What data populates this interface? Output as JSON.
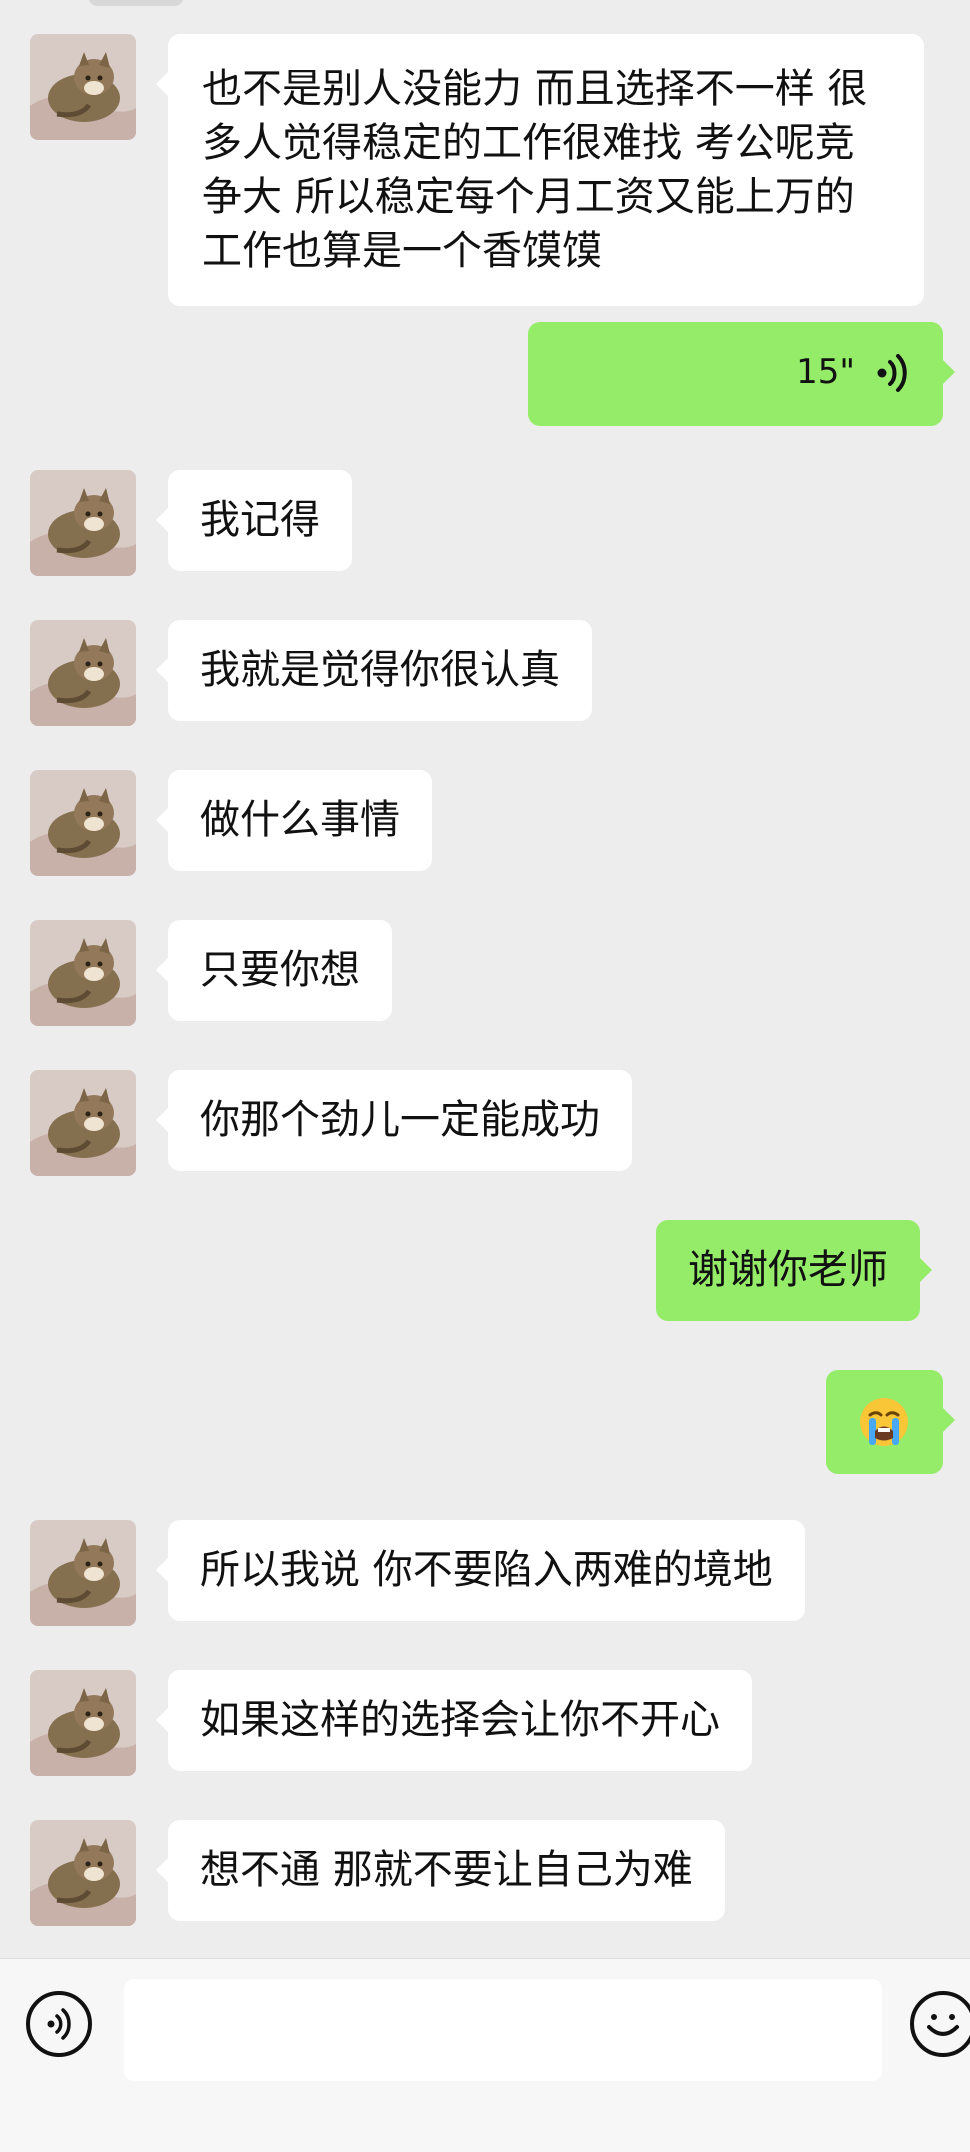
{
  "messages": [
    {
      "side": "left",
      "text": "也不是别人没能力 而且选择不一样 很多人觉得稳定的工作很难找 考公呢竞争大 所以稳定每个月工资又能上万的工作也算是一个香馍馍"
    },
    {
      "side": "right",
      "type": "voice",
      "duration": "15\""
    },
    {
      "side": "left",
      "text": "我记得"
    },
    {
      "side": "left",
      "text": "我就是觉得你很认真"
    },
    {
      "side": "left",
      "text": "做什么事情"
    },
    {
      "side": "left",
      "text": "只要你想"
    },
    {
      "side": "left",
      "text": "你那个劲儿一定能成功"
    },
    {
      "side": "right",
      "text": "谢谢你老师"
    },
    {
      "side": "right",
      "type": "emoji",
      "emoji": "loudly-crying-face"
    },
    {
      "side": "left",
      "text": "所以我说 你不要陷入两难的境地"
    },
    {
      "side": "left",
      "text": "如果这样的选择会让你不开心"
    },
    {
      "side": "left",
      "text": "想不通 那就不要让自己为难"
    }
  ],
  "colors": {
    "chat_background": "#ededed",
    "incoming_bubble": "#ffffff",
    "outgoing_bubble": "#95ec69",
    "input_bar": "#f7f7f7"
  },
  "icons": {
    "avatar": "cat-avatar",
    "voice_wave": "voice-wave-icon",
    "voice_toggle": "voice-input-icon",
    "emoji_toggle": "emoji-icon"
  },
  "input": {
    "value": ""
  }
}
